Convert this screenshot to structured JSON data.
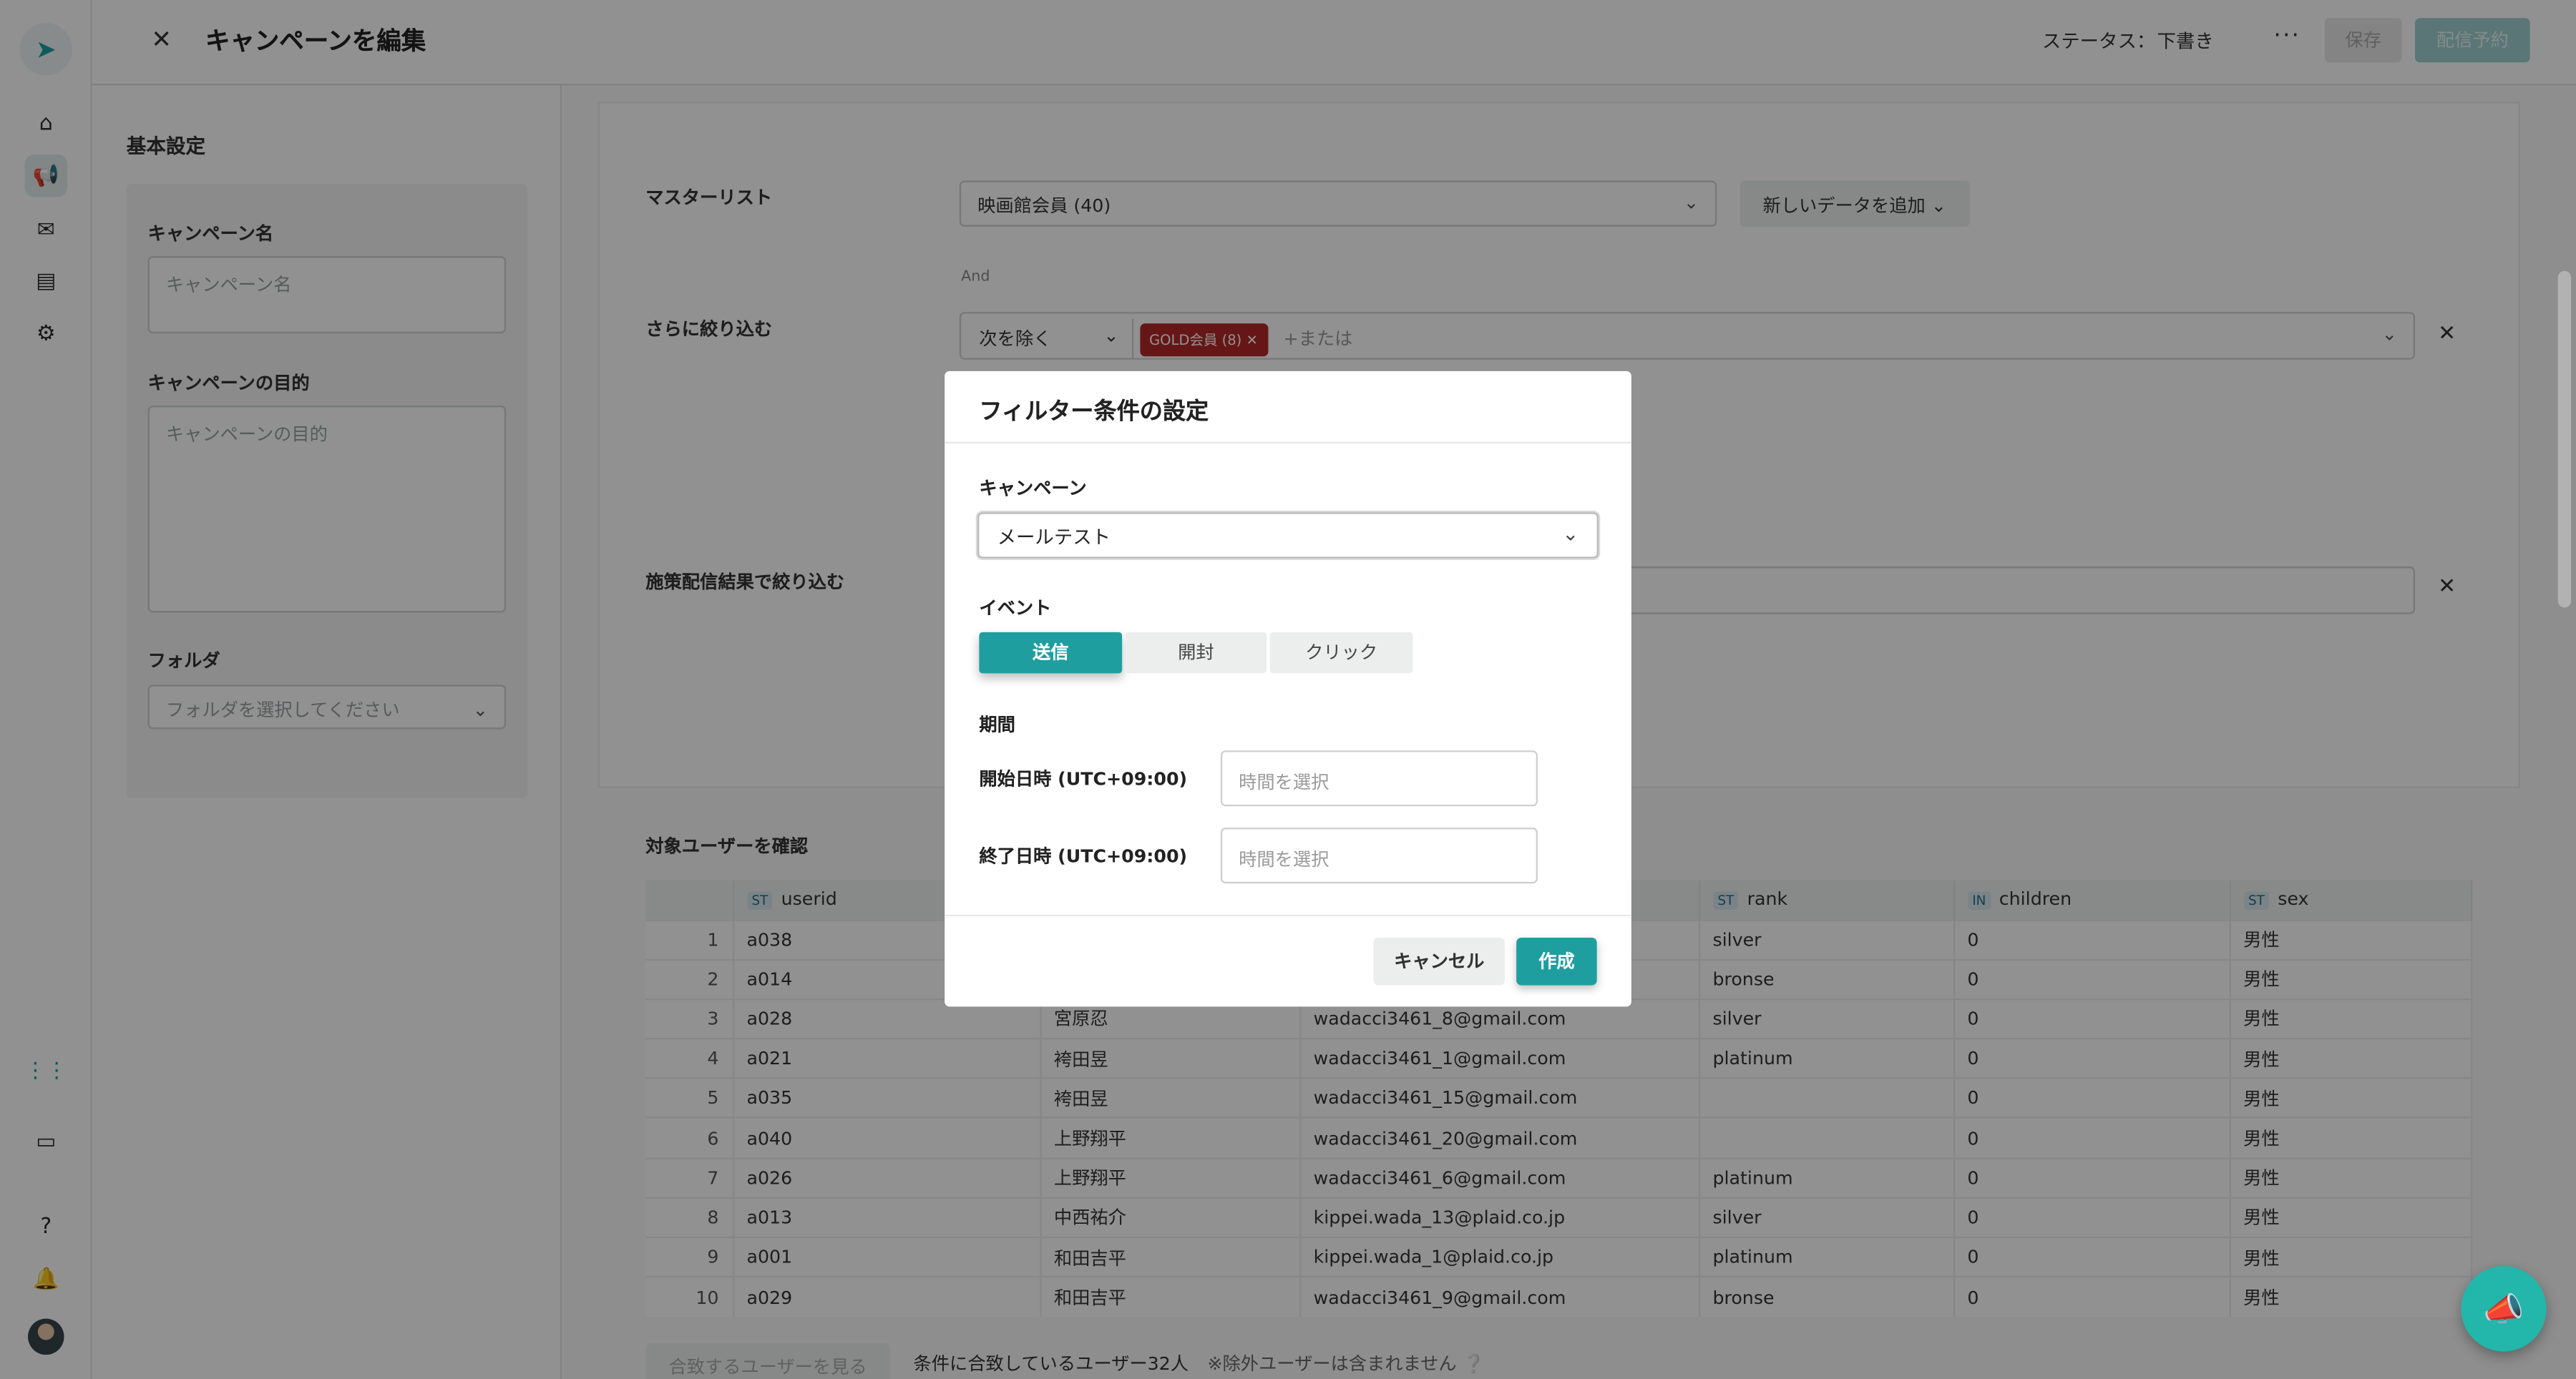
{
  "header": {
    "title": "キャンペーンを編集",
    "status_label": "ステータス：",
    "status_value": "下書き",
    "more": "···",
    "save": "保存",
    "schedule": "配信予約"
  },
  "left_panel": {
    "section_title": "基本設定",
    "campaign_name_label": "キャンペーン名",
    "campaign_name_placeholder": "キャンペーン名",
    "purpose_label": "キャンペーンの目的",
    "purpose_placeholder": "キャンペーンの目的",
    "folder_label": "フォルダ",
    "folder_placeholder": "フォルダを選択してください"
  },
  "main": {
    "master_list_label": "マスターリスト",
    "master_list_value": "映画館会員 (40)",
    "add_data_button": "新しいデータを追加",
    "and_label": "And",
    "narrow_label": "さらに絞り込む",
    "exclude_select": "次を除く",
    "tag": "GOLD会員 (8)",
    "or_placeholder": "+または",
    "delivery_filter_label": "施策配信結果で絞り込む",
    "table_title": "対象ユーザーを確認",
    "columns": [
      {
        "type": "ST",
        "name": "userid"
      },
      {
        "type": "",
        "name": ""
      },
      {
        "type": "",
        "name": ""
      },
      {
        "type": "ST",
        "name": "rank"
      },
      {
        "type": "IN",
        "name": "children"
      },
      {
        "type": "ST",
        "name": "sex"
      }
    ],
    "rows": [
      {
        "n": "1",
        "userid": "a038",
        "name": "",
        "email": "",
        "rank": "silver",
        "children": "0",
        "sex": "男性"
      },
      {
        "n": "2",
        "userid": "a014",
        "name": "",
        "email": "",
        "rank": "bronse",
        "children": "0",
        "sex": "男性"
      },
      {
        "n": "3",
        "userid": "a028",
        "name": "宮原忍",
        "email": "wadacci3461_8@gmail.com",
        "rank": "silver",
        "children": "0",
        "sex": "男性"
      },
      {
        "n": "4",
        "userid": "a021",
        "name": "袴田昱",
        "email": "wadacci3461_1@gmail.com",
        "rank": "platinum",
        "children": "0",
        "sex": "男性"
      },
      {
        "n": "5",
        "userid": "a035",
        "name": "袴田昱",
        "email": "wadacci3461_15@gmail.com",
        "rank": "",
        "children": "0",
        "sex": "男性"
      },
      {
        "n": "6",
        "userid": "a040",
        "name": "上野翔平",
        "email": "wadacci3461_20@gmail.com",
        "rank": "",
        "children": "0",
        "sex": "男性"
      },
      {
        "n": "7",
        "userid": "a026",
        "name": "上野翔平",
        "email": "wadacci3461_6@gmail.com",
        "rank": "platinum",
        "children": "0",
        "sex": "男性"
      },
      {
        "n": "8",
        "userid": "a013",
        "name": "中西祐介",
        "email": "kippei.wada_13@plaid.co.jp",
        "rank": "silver",
        "children": "0",
        "sex": "男性"
      },
      {
        "n": "9",
        "userid": "a001",
        "name": "和田吉平",
        "email": "kippei.wada_1@plaid.co.jp",
        "rank": "platinum",
        "children": "0",
        "sex": "男性"
      },
      {
        "n": "10",
        "userid": "a029",
        "name": "和田吉平",
        "email": "wadacci3461_9@gmail.com",
        "rank": "bronse",
        "children": "0",
        "sex": "男性"
      }
    ],
    "matching_button": "合致するユーザーを見る",
    "matching_count": "条件に合致しているユーザー32人",
    "matching_note": "※除外ユーザーは含まれません"
  },
  "modal": {
    "title": "フィルター条件の設定",
    "campaign_label": "キャンペーン",
    "campaign_value": "メールテスト",
    "event_label": "イベント",
    "events": [
      "送信",
      "開封",
      "クリック"
    ],
    "period_label": "期間",
    "start_label": "開始日時 (UTC+09:00)",
    "end_label": "終了日時 (UTC+09:00)",
    "time_placeholder": "時間を選択",
    "cancel": "キャンセル",
    "create": "作成"
  },
  "colors": {
    "accent": "#1f9ea0",
    "tag": "#b32828",
    "fab": "#23b6ab"
  }
}
